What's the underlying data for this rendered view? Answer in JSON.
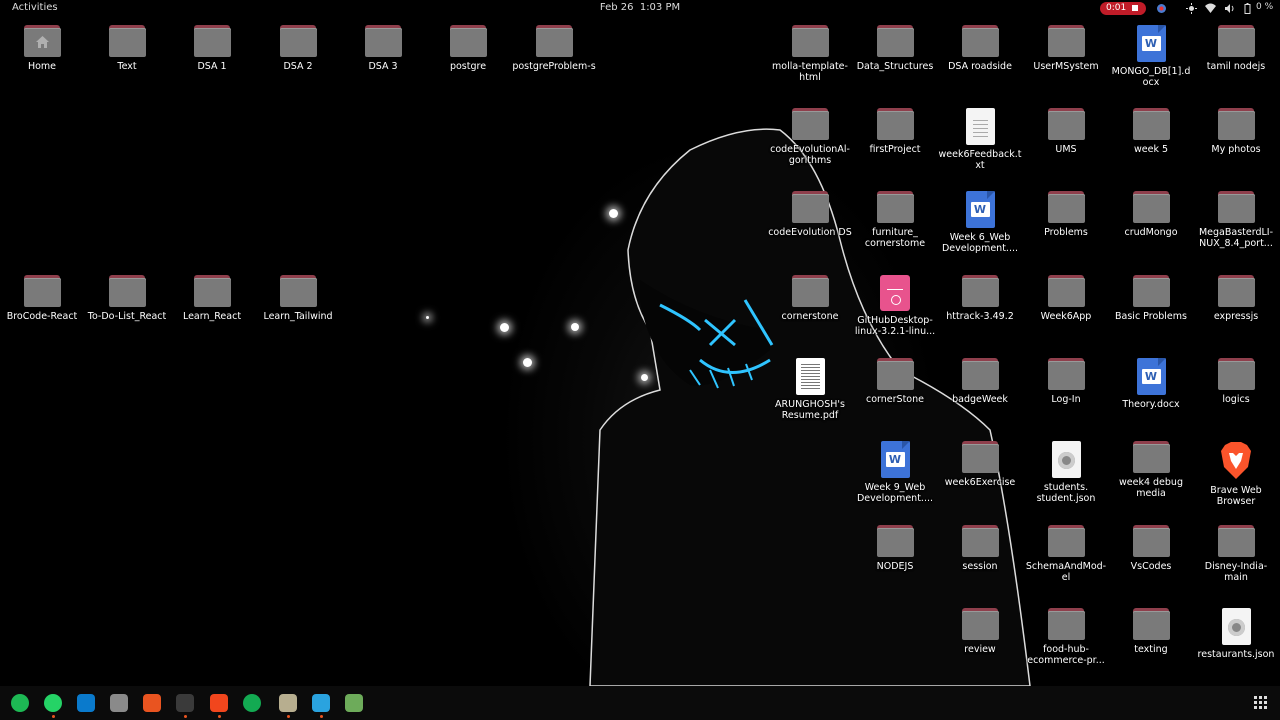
{
  "topbar": {
    "activities": "Activities",
    "date": "Feb 26",
    "time": "1:03 PM",
    "recording": "0:01",
    "battery": "0 %"
  },
  "tray_icons": [
    "color-picker-icon",
    "brightness-icon",
    "wifi-icon",
    "volume-icon",
    "battery-icon"
  ],
  "desktop": {
    "icons": [
      {
        "label": "Home",
        "type": "home"
      },
      {
        "label": "Text",
        "type": "folder"
      },
      {
        "label": "DSA 1",
        "type": "folder"
      },
      {
        "label": "DSA 2",
        "type": "folder"
      },
      {
        "label": "DSA 3",
        "type": "folder"
      },
      {
        "label": "postgre",
        "type": "folder"
      },
      {
        "label": "postgreProblem-s",
        "type": "folder"
      },
      {
        "label": "BroCode-React",
        "type": "folder"
      },
      {
        "label": "To-Do-List_React",
        "type": "folder"
      },
      {
        "label": "Learn_React",
        "type": "folder"
      },
      {
        "label": "Learn_Tailwind",
        "type": "folder"
      },
      {
        "label": "molla-template-html",
        "type": "folder"
      },
      {
        "label": "Data_Structures",
        "type": "folder"
      },
      {
        "label": "DSA roadside",
        "type": "folder"
      },
      {
        "label": "UserMSystem",
        "type": "folder"
      },
      {
        "label": "MONGO_DB[1].docx",
        "type": "docx"
      },
      {
        "label": "tamil nodejs",
        "type": "folder"
      },
      {
        "label": "codeEvolutionAl-gorithms",
        "type": "folder"
      },
      {
        "label": "firstProject",
        "type": "folder"
      },
      {
        "label": "week6Feedback.txt",
        "type": "txt"
      },
      {
        "label": "UMS",
        "type": "folder"
      },
      {
        "label": "week 5",
        "type": "folder"
      },
      {
        "label": "My photos",
        "type": "folder"
      },
      {
        "label": "codeEvolution DS",
        "type": "folder"
      },
      {
        "label": "furniture_ cornerstome",
        "type": "folder"
      },
      {
        "label": "Week 6_Web Development....",
        "type": "docx"
      },
      {
        "label": "Problems",
        "type": "folder"
      },
      {
        "label": "crudMongo",
        "type": "folder"
      },
      {
        "label": "MegaBasterdLI-NUX_8.4_port...",
        "type": "folder"
      },
      {
        "label": "cornerstone",
        "type": "folder"
      },
      {
        "label": "GitHubDesktop-linux-3.2.1-linu...",
        "type": "package"
      },
      {
        "label": "httrack-3.49.2",
        "type": "folder"
      },
      {
        "label": "Week6App",
        "type": "folder"
      },
      {
        "label": "Basic Problems",
        "type": "folder"
      },
      {
        "label": "expressjs",
        "type": "folder"
      },
      {
        "label": "ARUNGHOSH's Resume.pdf",
        "type": "pdf"
      },
      {
        "label": "cornerStone",
        "type": "folder"
      },
      {
        "label": "badgeWeek",
        "type": "folder"
      },
      {
        "label": "Log-In",
        "type": "folder"
      },
      {
        "label": "Theory.docx",
        "type": "docx"
      },
      {
        "label": "logics",
        "type": "folder"
      },
      {
        "label": "Week 9_Web Development....",
        "type": "docx"
      },
      {
        "label": "week6Exercise",
        "type": "folder"
      },
      {
        "label": "students. student.json",
        "type": "json"
      },
      {
        "label": "week4 debug media",
        "type": "folder"
      },
      {
        "label": "Brave Web Browser",
        "type": "brave"
      },
      {
        "label": "NODEJS",
        "type": "folder"
      },
      {
        "label": "session",
        "type": "folder"
      },
      {
        "label": "SchemaAndMod-el",
        "type": "folder"
      },
      {
        "label": "VsCodes",
        "type": "folder"
      },
      {
        "label": "Disney-India-main",
        "type": "folder"
      },
      {
        "label": "review",
        "type": "folder"
      },
      {
        "label": "food-hub-ecommerce-pr...",
        "type": "folder"
      },
      {
        "label": "texting",
        "type": "folder"
      },
      {
        "label": "restaurants.json",
        "type": "json"
      }
    ]
  },
  "dock": {
    "apps": [
      {
        "name": "spotify-icon",
        "color": "#1db954"
      },
      {
        "name": "whatsapp-icon",
        "color": "#25d366"
      },
      {
        "name": "vscode-icon",
        "color": "#0a7acc"
      },
      {
        "name": "files-icon",
        "color": "#8a8a8a"
      },
      {
        "name": "app-center-icon",
        "color": "#e95420"
      },
      {
        "name": "terminal-icon",
        "color": "#3a3a3a"
      },
      {
        "name": "brave-icon",
        "color": "#f1461d"
      },
      {
        "name": "mongodb-compass-icon",
        "color": "#13aa52"
      },
      {
        "name": "archive-manager-icon",
        "color": "#b7ae8f"
      },
      {
        "name": "telegram-icon",
        "color": "#2aa3df"
      },
      {
        "name": "trash-icon",
        "color": "#6dab5a"
      }
    ]
  }
}
